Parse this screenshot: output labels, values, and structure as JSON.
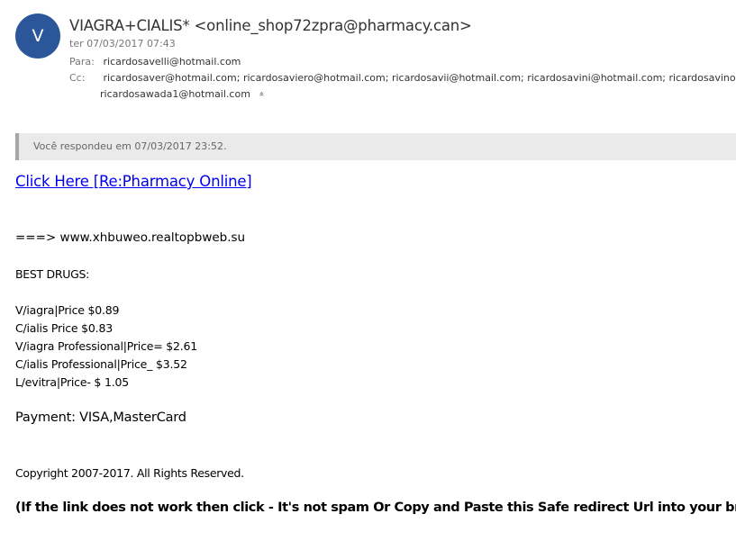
{
  "header": {
    "avatar_initial": "V",
    "sender": "VIAGRA+CIALIS* <online_shop72zpra@pharmacy.can>",
    "date": "ter 07/03/2017 07:43",
    "to_label": "Para:",
    "to_value": "ricardosavelli@hotmail.com",
    "cc_label": "Cc:",
    "cc_value": "ricardosaver@hotmail.com; ricardosaviero@hotmail.com; ricardosavii@hotmail.com; ricardosavini@hotmail.com; ricardosavino@hotmail.com;",
    "cc_value_2": "ricardosawada1@hotmail.com",
    "collapse_icon": "«"
  },
  "replied_notice": "Você respondeu em 07/03/2017 23:52.",
  "body": {
    "link_text": "Click Here [Re:Pharmacy Online]",
    "url_line": "===> www.xhbuweo.realtopbweb.su",
    "best_drugs": "BEST DRUGS:",
    "drugs": [
      "V/iagra|Price $0.89",
      "C/ialis Price $0.83",
      "V/iagra Professional|Price= $2.61",
      "C/ialis Professional|Price_ $3.52",
      "L/evitra|Price- $ 1.05"
    ],
    "payment": "Payment: VISA,MasterCard",
    "copyright": "Copyright 2007-2017. All Rights Reserved.",
    "notice": "(If the link does not work then click - It's not spam Or Copy and Paste this Safe redirect Url into your browser)"
  },
  "colors": {
    "avatar_bg": "#2b579a",
    "link": "#0000ee",
    "replied_bar_bg": "#eaeaea",
    "replied_bar_border": "#a6a6a6"
  }
}
